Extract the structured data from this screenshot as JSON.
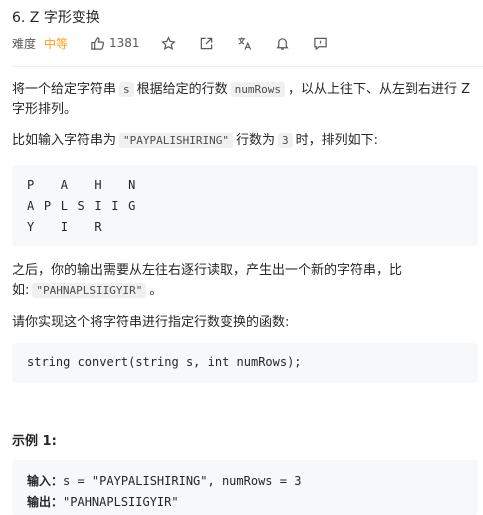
{
  "problem": {
    "title": "6. Z 字形变换",
    "difficulty_label": "难度",
    "difficulty": "中等",
    "likes": "1381",
    "difficulty_color": "#ffa116"
  },
  "toolbar": {
    "icons": [
      "thumbs-up-icon",
      "star-icon",
      "share-icon",
      "translate-icon",
      "bell-icon",
      "comment-icon"
    ]
  },
  "description": {
    "p1": {
      "a": "将一个给定字符串",
      "code1": "s",
      "b": "根据给定的行数",
      "code2": "numRows",
      "c": "，以从上往下、从左到右进行 Z 字形排列。"
    },
    "p2": {
      "a": "比如输入字符串为",
      "code1": "\"PAYPALISHIRING\"",
      "b": "行数为",
      "code2": "3",
      "c": "时，排列如下:"
    },
    "zigzag": [
      "P   A   H   N",
      "A P L S I I G",
      "Y   I   R"
    ],
    "p3": {
      "a": "之后，你的输出需要从左往右逐行读取，产生出一个新的字符串，比如:",
      "code1": "\"PAHNAPLSIIGYIR\"",
      "b": "。"
    },
    "p4": "请你实现这个将字符串进行指定行数变换的函数:",
    "signature": "string convert(string s, int numRows);"
  },
  "example": {
    "title": "示例 1:",
    "input_label": "输入：",
    "input_value": "s = \"PAYPALISHIRING\", numRows = 3",
    "output_label": "输出：",
    "output_value": "\"PAHNAPLSIIGYIR\""
  }
}
